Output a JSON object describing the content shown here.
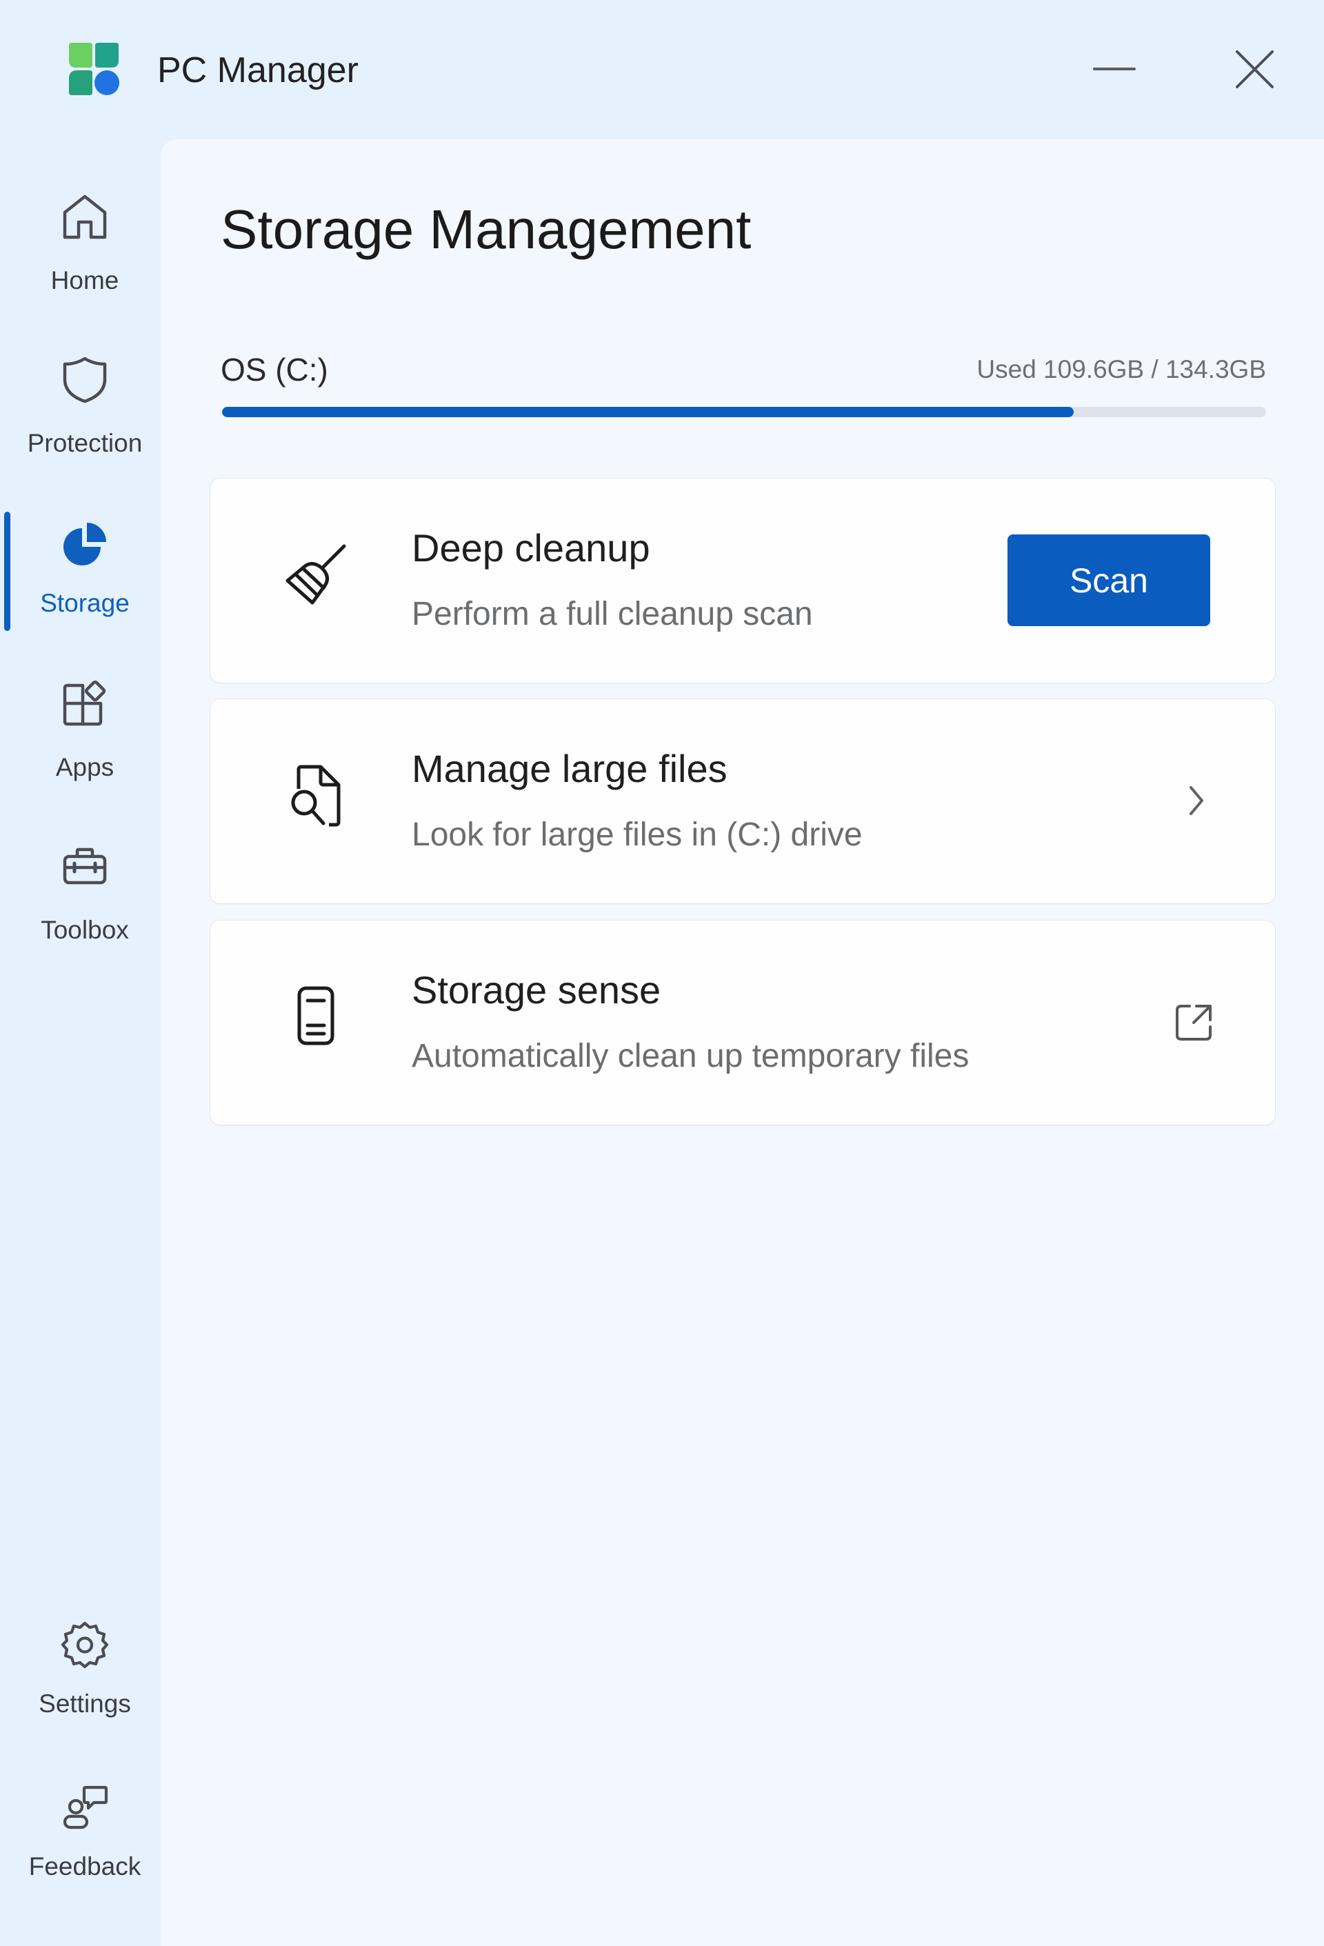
{
  "app": {
    "title": "PC Manager",
    "logo_colors": [
      "#7fd35b",
      "#23a086",
      "#2a9d7d",
      "#1e73e0"
    ],
    "window_controls": {
      "minimize_icon": "minimize-icon",
      "close_icon": "close-icon"
    }
  },
  "sidebar": {
    "active": "Storage",
    "accent_color": "#0f5fbf",
    "items": [
      {
        "label": "Home",
        "icon": "home-icon"
      },
      {
        "label": "Protection",
        "icon": "shield-icon"
      },
      {
        "label": "Storage",
        "icon": "pie-chart-icon"
      },
      {
        "label": "Apps",
        "icon": "apps-grid-icon"
      },
      {
        "label": "Toolbox",
        "icon": "toolbox-icon"
      }
    ],
    "bottom_items": [
      {
        "label": "Settings",
        "icon": "gear-icon"
      },
      {
        "label": "Feedback",
        "icon": "feedback-icon"
      }
    ]
  },
  "main": {
    "title": "Storage Management",
    "drive": {
      "label": "OS (C:)",
      "usage_text": "Used 109.6GB / 134.3GB",
      "used_gb": 109.6,
      "total_gb": 134.3,
      "used_fraction": 0.816
    },
    "cards": [
      {
        "title": "Deep cleanup",
        "subtitle": "Perform a full cleanup scan",
        "icon": "broom-icon",
        "action": {
          "type": "button",
          "label": "Scan"
        }
      },
      {
        "title": "Manage large files",
        "subtitle": "Look for large files in (C:) drive",
        "icon": "file-search-icon",
        "action": {
          "type": "chevron",
          "icon": "chevron-right-icon"
        }
      },
      {
        "title": "Storage sense",
        "subtitle": "Automatically clean up temporary files",
        "icon": "storage-device-icon",
        "action": {
          "type": "external-link",
          "icon": "external-link-icon"
        }
      }
    ]
  }
}
